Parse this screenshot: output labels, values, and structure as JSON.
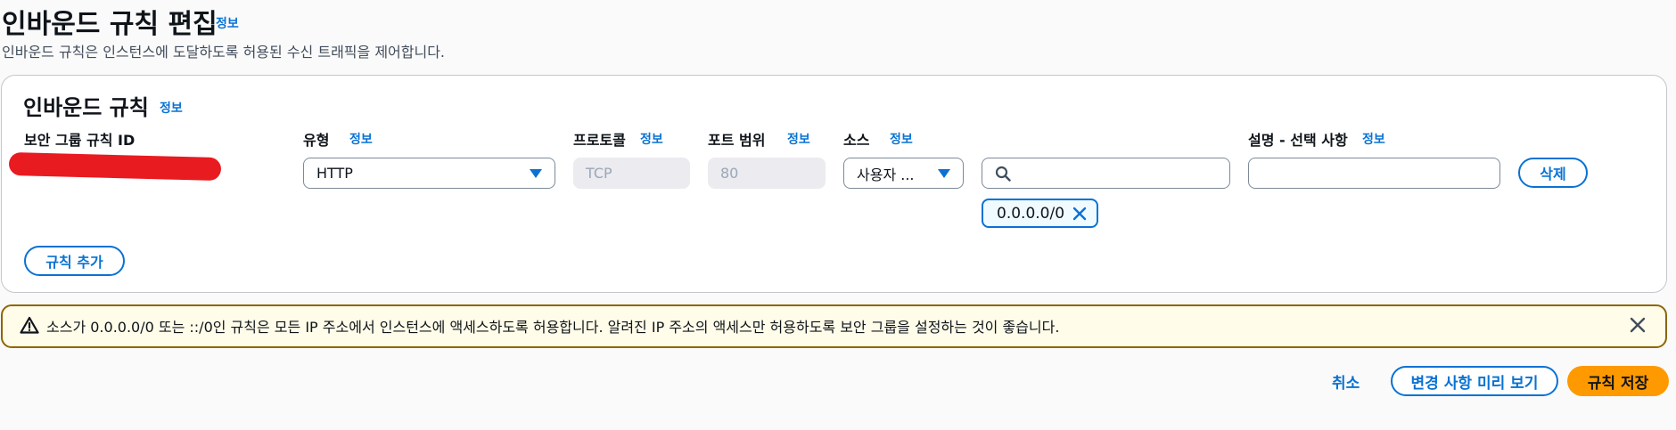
{
  "header": {
    "title": "인바운드 규칙 편집",
    "info_label": "정보",
    "description": "인바운드 규칙은 인스턴스에 도달하도록 허용된 수신 트래픽을 제어합니다."
  },
  "rules_card": {
    "title": "인바운드 규칙",
    "info_label": "정보",
    "columns": {
      "rule_id": "보안 그룹 규칙 ID",
      "type": "유형",
      "protocol": "프로토콜",
      "port_range": "포트 범위",
      "source": "소스",
      "description": "설명 - 선택 사항"
    },
    "row": {
      "type_value": "HTTP",
      "protocol_value": "TCP",
      "port_value": "80",
      "source_value": "사용자 ...",
      "search_value": "",
      "description_value": "",
      "cidr_token": "0.0.0.0/0",
      "delete_label": "삭제"
    },
    "add_rule_label": "규칙 추가"
  },
  "alert": {
    "text": "소스가 0.0.0.0/0 또는 ::/0인 규칙은 모든 IP 주소에서 인스턴스에 액세스하도록 허용합니다. 알려진 IP 주소의 액세스만 허용하도록 보안 그룹을 설정하는 것이 좋습니다."
  },
  "footer": {
    "cancel_label": "취소",
    "preview_label": "변경 사항 미리 보기",
    "save_label": "규칙 저장"
  },
  "colors": {
    "accent": "#0972d3",
    "primary_button": "#ff9900",
    "warning_border": "#8d6605",
    "warning_bg": "#fffce9"
  }
}
